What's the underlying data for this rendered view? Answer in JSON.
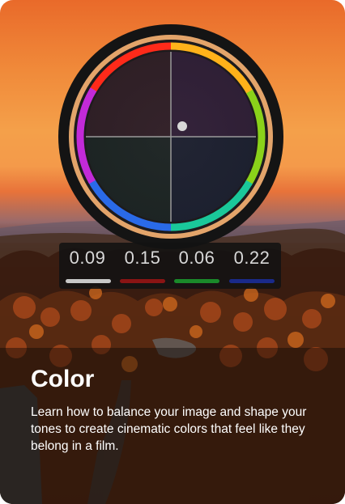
{
  "card": {
    "title": "Color",
    "description": "Learn how to balance your image and shape your tones to create cinematic colors that feel like they belong in a film."
  },
  "color_wheel": {
    "metrics": [
      {
        "value": "0.09",
        "bar_color": "#c8c8c8"
      },
      {
        "value": "0.15",
        "bar_color": "#8a1414"
      },
      {
        "value": "0.06",
        "bar_color": "#1a8a2a"
      },
      {
        "value": "0.22",
        "bar_color": "#1a2a8a"
      }
    ]
  },
  "colors": {
    "sky_top": "#e96a2a",
    "sky_glow": "#f4a04a",
    "forest_dark": "#2a1a0e",
    "wheel_ring": "#e3a46a",
    "text": "#ffffff"
  }
}
